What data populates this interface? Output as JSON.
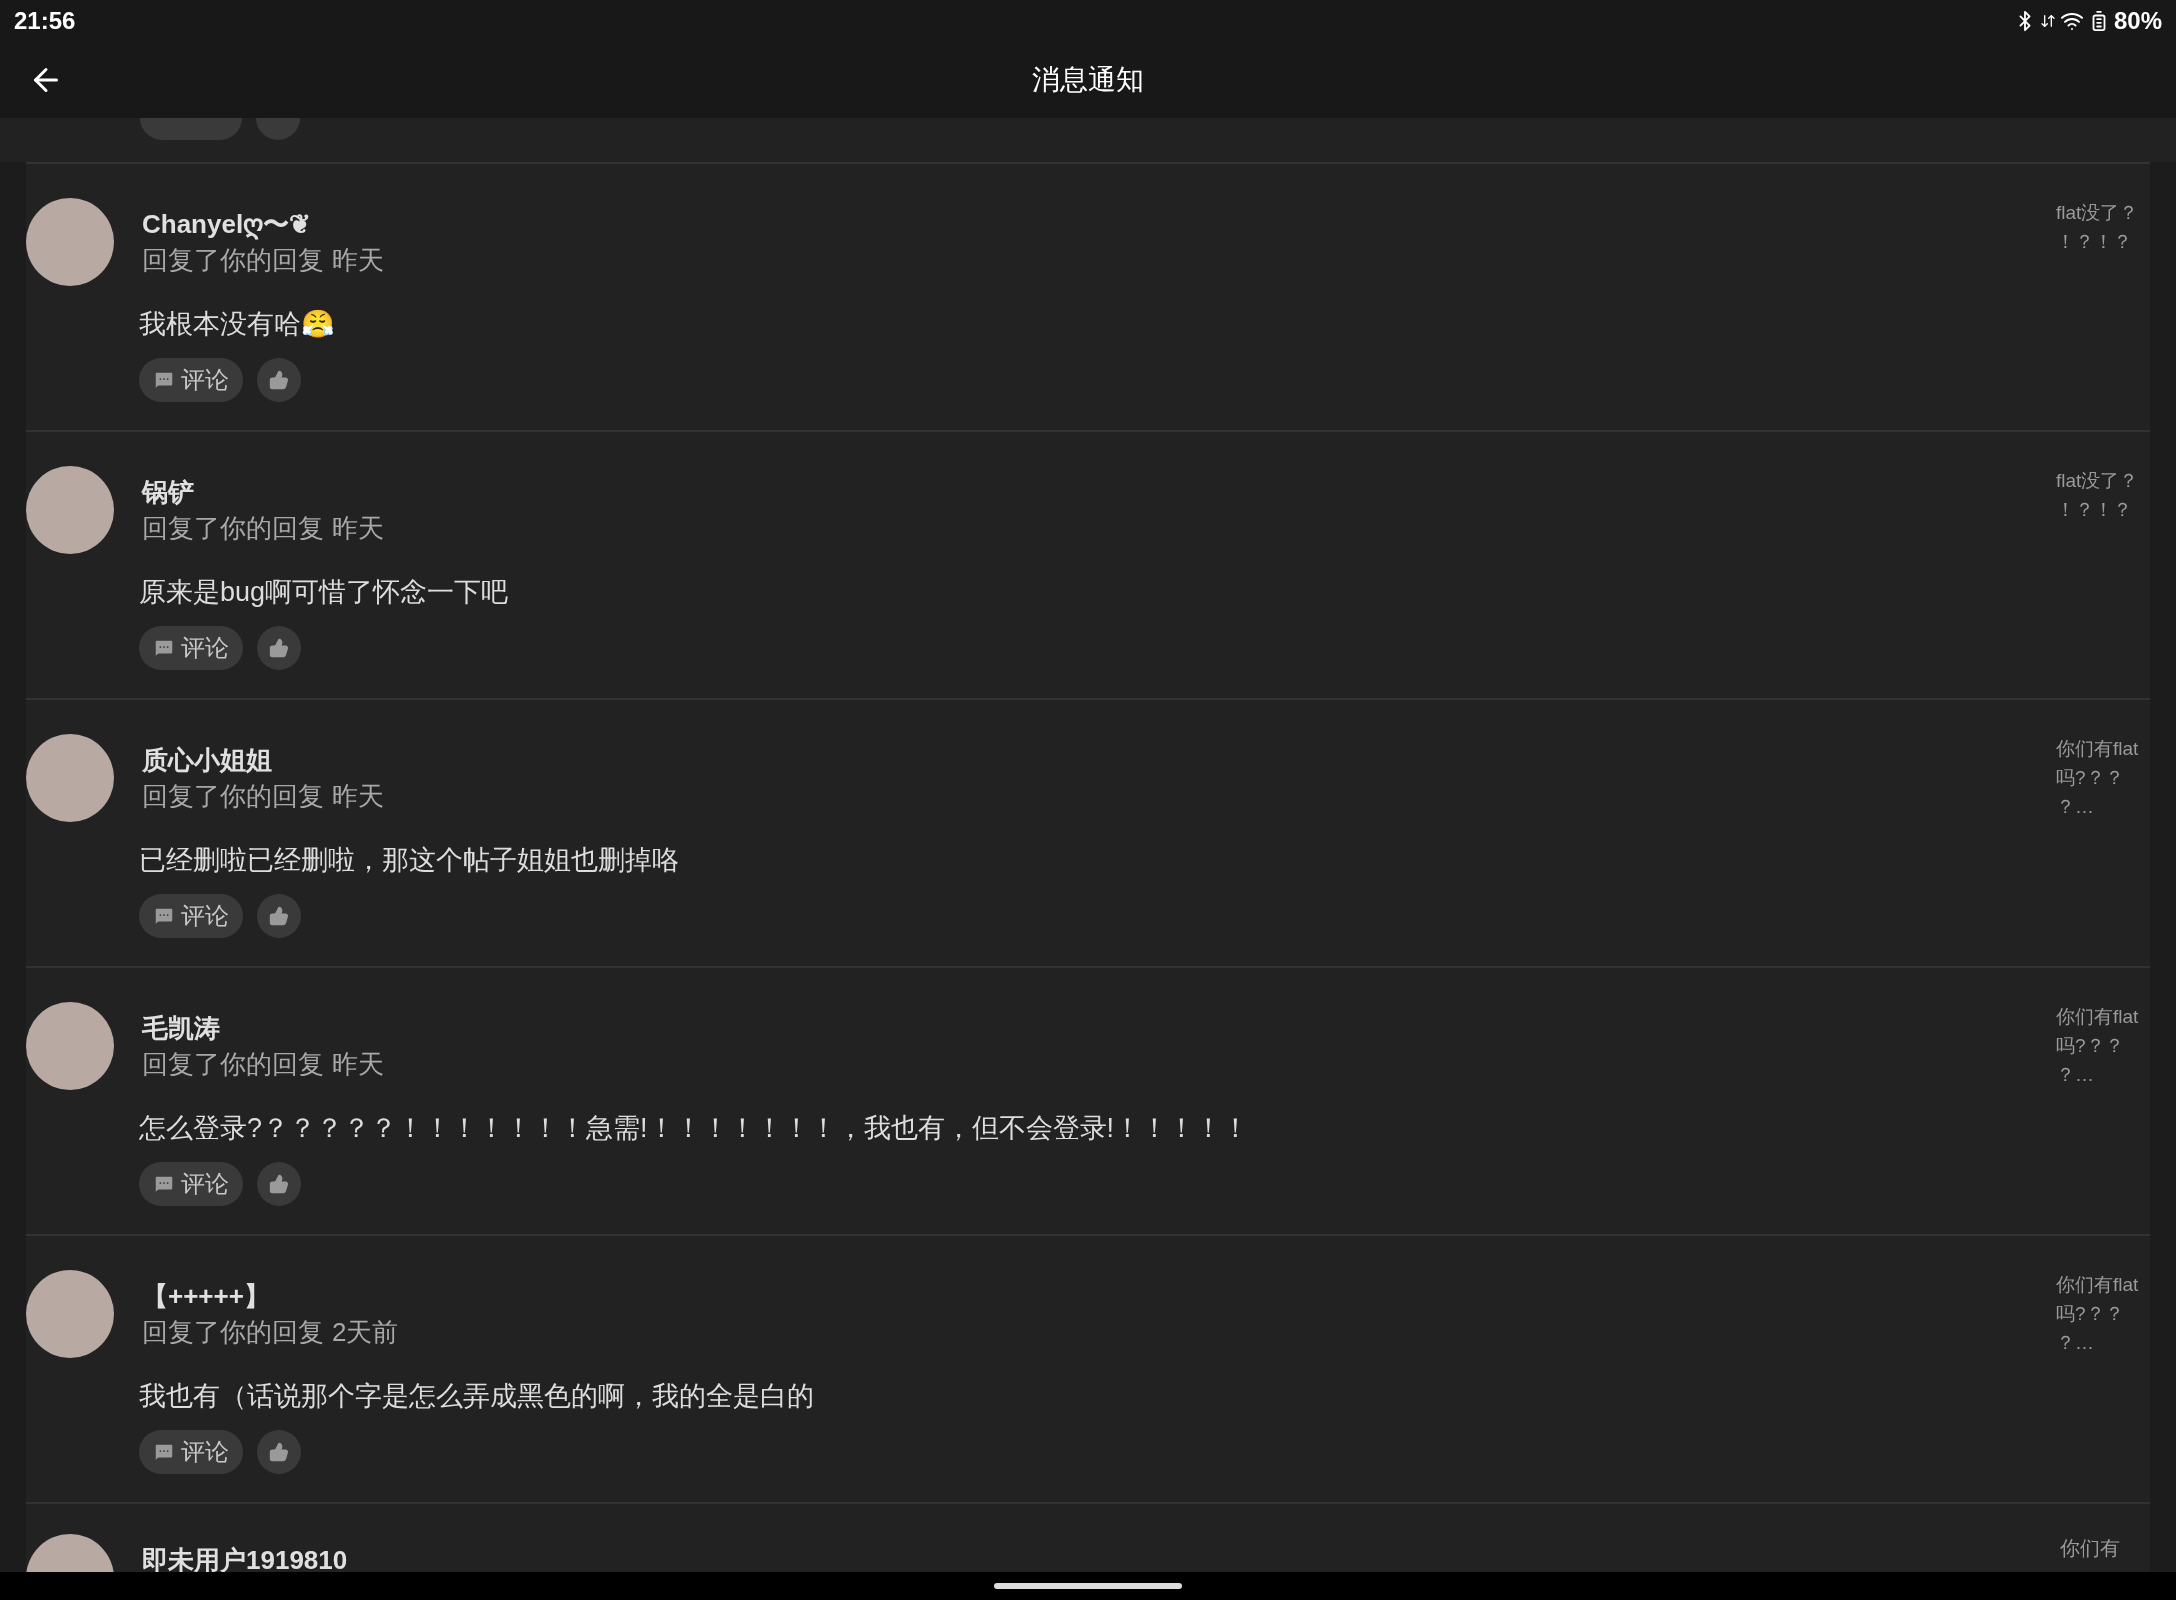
{
  "status_bar": {
    "time": "21:56",
    "battery": "80%"
  },
  "app_bar": {
    "title": "消息通知"
  },
  "notifications": [
    {
      "name": "Chanyelღ〜❦",
      "action": "回复了你的回复",
      "time": "昨天",
      "body": "我根本没有哈😤",
      "comment": "评论",
      "snippet": "flat没了？！？！？"
    },
    {
      "name": "锅铲",
      "action": "回复了你的回复",
      "time": "昨天",
      "body": "原来是bug啊可惜了怀念一下吧",
      "comment": "评论",
      "snippet": "flat没了？！？！？"
    },
    {
      "name": "质心小姐姐",
      "action": "回复了你的回复",
      "time": "昨天",
      "body": "已经删啦已经删啦，那这个帖子姐姐也删掉咯",
      "comment": "评论",
      "snippet": "你们有flat吗?？？？…"
    },
    {
      "name": "毛凯涛",
      "action": "回复了你的回复",
      "time": "昨天",
      "body": "怎么登录?？？？？？！！！！！！！急需!！！！！！！！，我也有，但不会登录!！！！！！",
      "comment": "评论",
      "snippet": "你们有flat吗?？？？…"
    },
    {
      "name": "【+++++】",
      "action": "回复了你的回复",
      "time": "2天前",
      "body": "我也有（话说那个字是怎么弄成黑色的啊，我的全是白的",
      "comment": "评论",
      "snippet": "你们有flat吗?？？？…"
    }
  ],
  "partial_item": {
    "name": "即未用户1919810",
    "snippet": "你们有"
  }
}
